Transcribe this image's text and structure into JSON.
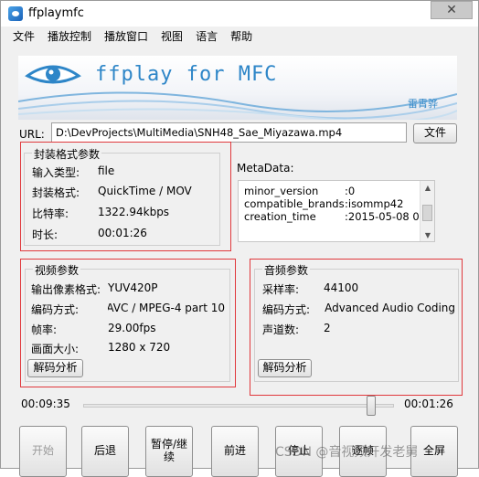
{
  "window": {
    "title": "ffplaymfc",
    "close_glyph": "✕"
  },
  "menu": [
    "文件",
    "播放控制",
    "播放窗口",
    "视图",
    "语言",
    "帮助"
  ],
  "banner": {
    "title": "ffplay for MFC",
    "author": "雷霄骅"
  },
  "url": {
    "label": "URL:",
    "value": "D:\\DevProjects\\MultiMedia\\SNH48_Sae_Miyazawa.mp4",
    "browse_button": "文件"
  },
  "format": {
    "title": "封装格式参数",
    "rows": [
      {
        "label": "输入类型:",
        "value": "file"
      },
      {
        "label": "封装格式:",
        "value": "QuickTime / MOV"
      },
      {
        "label": "比特率:",
        "value": "1322.94kbps"
      },
      {
        "label": "时长:",
        "value": "00:01:26"
      }
    ]
  },
  "metadata": {
    "title": "MetaData:",
    "rows": [
      {
        "key": "minor_version",
        "value": ":0"
      },
      {
        "key": "compatible_brands",
        "value": ":isommp42"
      },
      {
        "key": "creation_time",
        "value": ":2015-05-08 0"
      }
    ]
  },
  "video": {
    "title": "视频参数",
    "rows": [
      {
        "label": "输出像素格式:",
        "value": "YUV420P"
      },
      {
        "label": "编码方式:",
        "value": "AVC / MPEG-4 part 10"
      },
      {
        "label": "帧率:",
        "value": "29.00fps"
      },
      {
        "label": "画面大小:",
        "value": "1280 x 720"
      }
    ],
    "decode_button": "解码分析"
  },
  "audio": {
    "title": "音频参数",
    "rows": [
      {
        "label": "采样率:",
        "value": "44100"
      },
      {
        "label": "编码方式:",
        "value": "Advanced Audio Coding)"
      },
      {
        "label": "声道数:",
        "value": "2"
      }
    ],
    "decode_button": "解码分析"
  },
  "playback": {
    "current_time": "00:09:35",
    "total_time": "00:01:26",
    "position": 0.94
  },
  "controls": [
    "开始",
    "后退",
    "暂停/继续",
    "前进",
    "停止",
    "逐帧",
    "全屏"
  ],
  "watermark": "CSDN @音视频开发老舅",
  "colors": {
    "highlight_red": "#e0383c",
    "banner_blue": "#2e86c8"
  }
}
